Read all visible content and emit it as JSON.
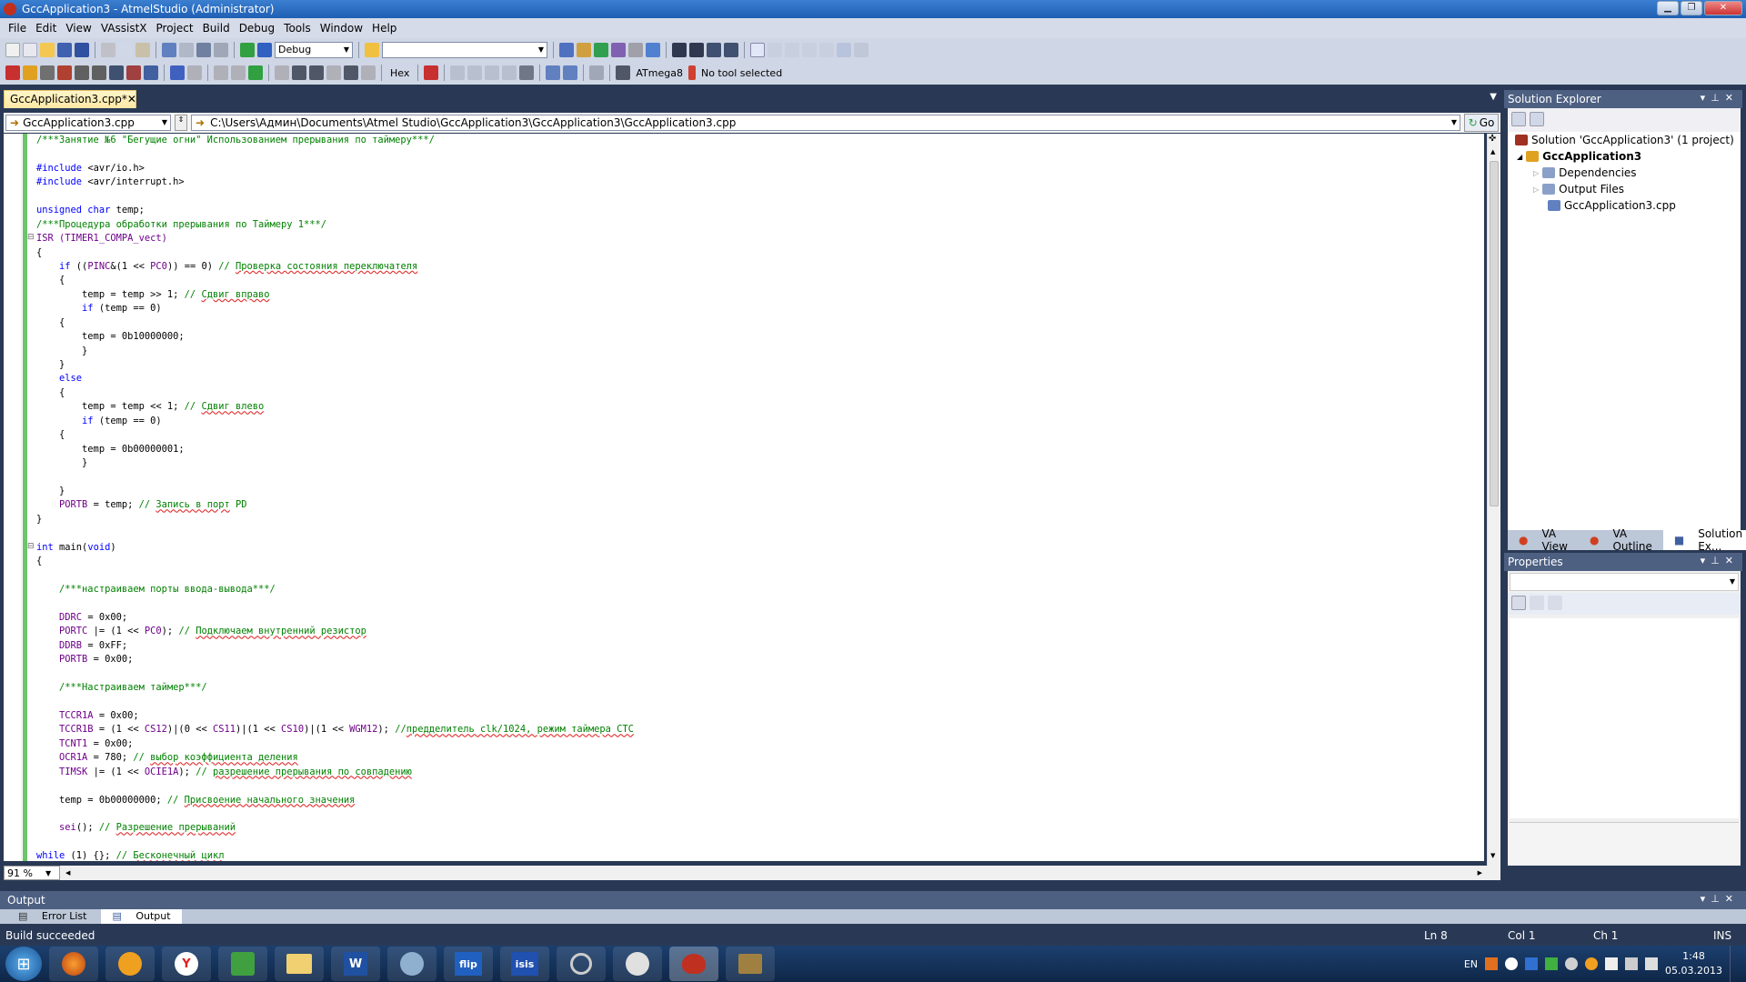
{
  "window": {
    "title": "GccApplication3 - AtmelStudio (Administrator)"
  },
  "menu": [
    "File",
    "Edit",
    "View",
    "VAssistX",
    "Project",
    "Build",
    "Debug",
    "Tools",
    "Window",
    "Help"
  ],
  "toolbar": {
    "config": "Debug",
    "search": "",
    "hex_label": "Hex",
    "device": "ATmega8",
    "tool": "No tool selected"
  },
  "document": {
    "tab_title": "GccApplication3.cpp*",
    "file_combo": "GccApplication3.cpp",
    "path": "C:\\Users\\Админ\\Documents\\Atmel Studio\\GccApplication3\\GccApplication3\\GccApplication3.cpp",
    "go_label": "Go",
    "zoom": "91 %"
  },
  "code_lines": [
    [
      {
        "t": "/***Занятие №6 \"Бегущие огни\" Использованием прерывания по таймеру***/",
        "c": "cm"
      }
    ],
    [],
    [
      {
        "t": "#include ",
        "c": "pp"
      },
      {
        "t": "<avr/io.h>"
      }
    ],
    [
      {
        "t": "#include ",
        "c": "pp"
      },
      {
        "t": "<avr/interrupt.h>"
      }
    ],
    [],
    [
      {
        "t": "unsigned char",
        "c": "kw"
      },
      {
        "t": " temp;"
      }
    ],
    [
      {
        "t": "/***Процедура обработки прерывания по Таймеру 1***/",
        "c": "cm"
      }
    ],
    [
      {
        "t": "ISR (",
        "c": "mac"
      },
      {
        "t": "TIMER1_COMPA_vect",
        "c": "mac"
      },
      {
        "t": ")",
        "c": "mac"
      }
    ],
    [
      {
        "t": "{"
      }
    ],
    [
      {
        "t": "    "
      },
      {
        "t": "if",
        "c": "kw"
      },
      {
        "t": " (("
      },
      {
        "t": "PINC",
        "c": "mac"
      },
      {
        "t": "&(1 << "
      },
      {
        "t": "PC0",
        "c": "mac"
      },
      {
        "t": ")) == 0) "
      },
      {
        "t": "// ",
        "c": "cm"
      },
      {
        "t": "Проверка состояния переключателя",
        "c": "cm sq"
      }
    ],
    [
      {
        "t": "    {"
      }
    ],
    [
      {
        "t": "        temp = temp >> 1; "
      },
      {
        "t": "// ",
        "c": "cm"
      },
      {
        "t": "Сдвиг вправо",
        "c": "cm sq"
      }
    ],
    [
      {
        "t": "        "
      },
      {
        "t": "if",
        "c": "kw"
      },
      {
        "t": " (temp == 0)"
      }
    ],
    [
      {
        "t": "    {"
      }
    ],
    [
      {
        "t": "        temp = 0b10000000;"
      }
    ],
    [
      {
        "t": "        }"
      }
    ],
    [
      {
        "t": "    }"
      }
    ],
    [
      {
        "t": "    "
      },
      {
        "t": "else",
        "c": "kw"
      }
    ],
    [
      {
        "t": "    {"
      }
    ],
    [
      {
        "t": "        temp = temp << 1; "
      },
      {
        "t": "// ",
        "c": "cm"
      },
      {
        "t": "Сдвиг влево",
        "c": "cm sq"
      }
    ],
    [
      {
        "t": "        "
      },
      {
        "t": "if",
        "c": "kw"
      },
      {
        "t": " (temp == 0)"
      }
    ],
    [
      {
        "t": "    {"
      }
    ],
    [
      {
        "t": "        temp = 0b00000001;"
      }
    ],
    [
      {
        "t": "        }"
      }
    ],
    [],
    [
      {
        "t": "    }"
      }
    ],
    [
      {
        "t": "    "
      },
      {
        "t": "PORTB",
        "c": "mac"
      },
      {
        "t": " = temp; "
      },
      {
        "t": "// ",
        "c": "cm"
      },
      {
        "t": "Запись в порт",
        "c": "cm sq"
      },
      {
        "t": " PD",
        "c": "cm"
      }
    ],
    [
      {
        "t": "}"
      }
    ],
    [],
    [
      {
        "t": "int",
        "c": "kw"
      },
      {
        "t": " main("
      },
      {
        "t": "void",
        "c": "kw"
      },
      {
        "t": ")"
      }
    ],
    [
      {
        "t": "{"
      }
    ],
    [],
    [
      {
        "t": "    "
      },
      {
        "t": "/***настраиваем порты ввода-вывода***/",
        "c": "cm"
      }
    ],
    [],
    [
      {
        "t": "    "
      },
      {
        "t": "DDRC",
        "c": "mac"
      },
      {
        "t": " = 0x00;"
      }
    ],
    [
      {
        "t": "    "
      },
      {
        "t": "PORTC",
        "c": "mac"
      },
      {
        "t": " |= (1 << "
      },
      {
        "t": "PC0",
        "c": "mac"
      },
      {
        "t": "); "
      },
      {
        "t": "// ",
        "c": "cm"
      },
      {
        "t": "Подключаем внутренний резистор",
        "c": "cm sq"
      }
    ],
    [
      {
        "t": "    "
      },
      {
        "t": "DDRB",
        "c": "mac"
      },
      {
        "t": " = 0xFF;"
      }
    ],
    [
      {
        "t": "    "
      },
      {
        "t": "PORTB",
        "c": "mac"
      },
      {
        "t": " = 0x00;"
      }
    ],
    [],
    [
      {
        "t": "    "
      },
      {
        "t": "/***Настраиваем таймер***/",
        "c": "cm"
      }
    ],
    [],
    [
      {
        "t": "    "
      },
      {
        "t": "TCCR1A",
        "c": "mac"
      },
      {
        "t": " = 0x00;"
      }
    ],
    [
      {
        "t": "    "
      },
      {
        "t": "TCCR1B",
        "c": "mac"
      },
      {
        "t": " = (1 << "
      },
      {
        "t": "CS12",
        "c": "mac"
      },
      {
        "t": ")|(0 << "
      },
      {
        "t": "CS11",
        "c": "mac"
      },
      {
        "t": ")|(1 << "
      },
      {
        "t": "CS10",
        "c": "mac"
      },
      {
        "t": ")|(1 << "
      },
      {
        "t": "WGM12",
        "c": "mac"
      },
      {
        "t": "); "
      },
      {
        "t": "//",
        "c": "cm"
      },
      {
        "t": "предделитель clk/1024, режим таймера СТС",
        "c": "cm sq"
      }
    ],
    [
      {
        "t": "    "
      },
      {
        "t": "TCNT1",
        "c": "mac"
      },
      {
        "t": " = 0x00;"
      }
    ],
    [
      {
        "t": "    "
      },
      {
        "t": "OCR1A",
        "c": "mac"
      },
      {
        "t": " = 780; "
      },
      {
        "t": "// ",
        "c": "cm"
      },
      {
        "t": "выбор коэффициента деления",
        "c": "cm sq"
      }
    ],
    [
      {
        "t": "    "
      },
      {
        "t": "TIMSK",
        "c": "mac"
      },
      {
        "t": " |= (1 << "
      },
      {
        "t": "OCIE1A",
        "c": "mac"
      },
      {
        "t": "); "
      },
      {
        "t": "// ",
        "c": "cm"
      },
      {
        "t": "разрешение прерывания по совпадению",
        "c": "cm sq"
      }
    ],
    [],
    [
      {
        "t": "    temp = 0b00000000; "
      },
      {
        "t": "// ",
        "c": "cm"
      },
      {
        "t": "Присвоение начального значения",
        "c": "cm sq"
      }
    ],
    [],
    [
      {
        "t": "    "
      },
      {
        "t": "sei",
        "c": "mac"
      },
      {
        "t": "(); "
      },
      {
        "t": "// ",
        "c": "cm"
      },
      {
        "t": "Разрешение прерываний",
        "c": "cm sq"
      }
    ],
    [],
    [
      {
        "t": "while",
        "c": "kw"
      },
      {
        "t": " (1) {}; "
      },
      {
        "t": "// ",
        "c": "cm"
      },
      {
        "t": "Бесконечный цикл",
        "c": "cm sq"
      }
    ]
  ],
  "solution_explorer": {
    "title": "Solution Explorer",
    "solution": "Solution 'GccApplication3' (1 project)",
    "project": "GccApplication3",
    "items": [
      "Dependencies",
      "Output Files",
      "GccApplication3.cpp"
    ],
    "tabs": [
      "VA View",
      "VA Outline",
      "Solution Ex..."
    ]
  },
  "properties": {
    "title": "Properties"
  },
  "output": {
    "title": "Output",
    "tabs": [
      "Error List",
      "Output"
    ]
  },
  "status": {
    "message": "Build succeeded",
    "ln": "Ln 8",
    "col": "Col 1",
    "ch": "Ch 1",
    "mode": "INS"
  },
  "taskbar": {
    "apps": [
      "firefox",
      "avast",
      "yandex",
      "utorrent",
      "explorer",
      "word",
      "paint",
      "flip",
      "isis",
      "tool",
      "browser",
      "atmelstudio",
      "archiver"
    ],
    "lang": "EN",
    "time": "1:48",
    "date": "05.03.2013"
  },
  "colors": {
    "titlebar": "#2a6bc4",
    "menubar": "#d6dbe9",
    "frame": "#293955",
    "tab_active": "#ffe8a6",
    "comment": "#008000",
    "keyword": "#0000ff"
  }
}
